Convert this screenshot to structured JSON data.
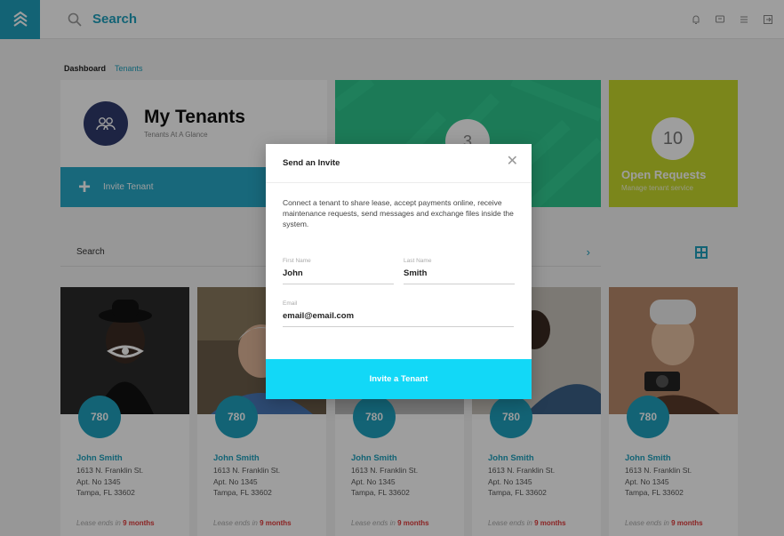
{
  "header": {
    "search_label": "Search"
  },
  "tabs": [
    {
      "label": "Dashboard",
      "active": true
    },
    {
      "label": "Tenants",
      "active": false
    }
  ],
  "my_tenants": {
    "title": "My Tenants",
    "subtitle": "Tenants At A Glance"
  },
  "invite_bar": {
    "label": "Invite Tenant"
  },
  "green_card": {
    "count": "3"
  },
  "requests_card": {
    "count": "10",
    "title": "Open Requests",
    "subtitle": "Manage tenant service"
  },
  "search_row": {
    "label": "Search"
  },
  "tenants": [
    {
      "badge": "780",
      "name": "John Smith",
      "addr1": "1613 N. Franklin St.",
      "addr2": "Apt. No 1345",
      "addr3": "Tampa, FL 33602",
      "lease_prefix": "Lease ends in",
      "lease_value": "9 months"
    },
    {
      "badge": "780",
      "name": "John Smith",
      "addr1": "1613 N. Franklin St.",
      "addr2": "Apt. No 1345",
      "addr3": "Tampa, FL 33602",
      "lease_prefix": "Lease ends in",
      "lease_value": "9 months"
    },
    {
      "badge": "780",
      "name": "John Smith",
      "addr1": "1613 N. Franklin St.",
      "addr2": "Apt. No 1345",
      "addr3": "Tampa, FL 33602",
      "lease_prefix": "Lease ends in",
      "lease_value": "9 months"
    },
    {
      "badge": "780",
      "name": "John Smith",
      "addr1": "1613 N. Franklin St.",
      "addr2": "Apt. No 1345",
      "addr3": "Tampa, FL 33602",
      "lease_prefix": "Lease ends in",
      "lease_value": "9 months"
    },
    {
      "badge": "780",
      "name": "John Smith",
      "addr1": "1613 N. Franklin St.",
      "addr2": "Apt. No 1345",
      "addr3": "Tampa, FL 33602",
      "lease_prefix": "Lease ends in",
      "lease_value": "9 months"
    }
  ],
  "modal": {
    "title": "Send an Invite",
    "description": "Connect a tenant to share lease, accept payments online, receive maintenance requests, send messages and exchange files inside the system.",
    "first_name_label": "First Name",
    "first_name_value": "John",
    "last_name_label": "Last Name",
    "last_name_value": "Smith",
    "email_label": "Email",
    "email_value": "email@email.com",
    "submit_label": "Invite a Tenant"
  },
  "colors": {
    "accent": "#1fa1bd",
    "green": "#2ec68d",
    "yellow": "#c7d92c",
    "submit": "#12d8f7",
    "lease_red": "#e03a3a"
  }
}
